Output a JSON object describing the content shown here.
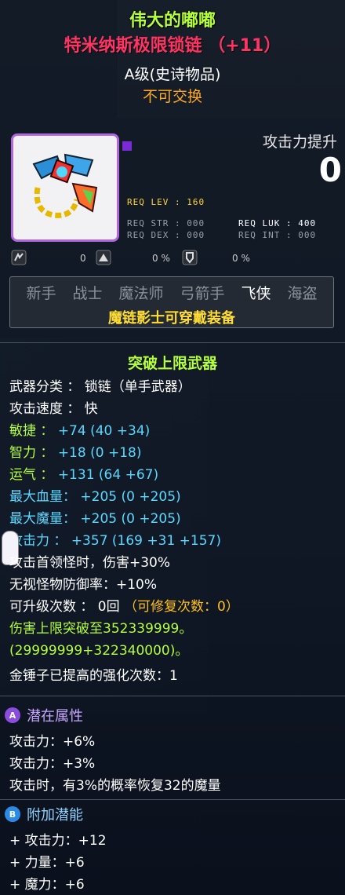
{
  "item": {
    "name": "伟大的嘟嘟",
    "full_title": "特米纳斯极限锁链 （+11）",
    "grade": "A级(史诗物品)",
    "trade": "不可交换",
    "attack_up_label": "攻击力提升",
    "attack_up_value": "0"
  },
  "requirements": {
    "lev": "REQ LEV : 160",
    "str": "REQ STR : 000",
    "dex": "REQ DEX : 000",
    "luk": "REQ LUK : 400",
    "int": "REQ INT : 000"
  },
  "stat_icons": [
    {
      "icon": "boss-damage-icon",
      "value": "0"
    },
    {
      "icon": "ignore-defense-icon",
      "value": "0 %"
    },
    {
      "icon": "shield-break-icon",
      "value": "0 %"
    }
  ],
  "jobs": {
    "list": [
      "新手",
      "战士",
      "魔法师",
      "弓箭手",
      "飞侠",
      "海盗"
    ],
    "active": "飞侠",
    "note": "魔链影士可穿戴装备"
  },
  "stats": {
    "section_title": "突破上限武器",
    "weapon_type_label": "武器分类 ： 锁链（单手武器）",
    "speed_label": "攻击速度 ： 快",
    "dex": {
      "label": "敏捷 ：",
      "text": "+74 (40 +34)"
    },
    "int": {
      "label": "智力 ：",
      "text": "+18 (0 +18)"
    },
    "luk": {
      "label": "运气 ：",
      "text": "+131 (64 +67)"
    },
    "maxhp": {
      "label": "最大血量：",
      "text": "+205 (0 +205)"
    },
    "maxmp": {
      "label": "最大魔量：",
      "text": "+205 (0 +205)"
    },
    "atk": {
      "label": "攻击力 ：",
      "text": "+357 (169 +31 +157)"
    },
    "boss": "攻击首领怪时，伤害+30%",
    "ignore_def": "无视怪物防御率：+10%",
    "upgrades": "可升级次数 ： 0回",
    "repair": "（可修复次数：0）",
    "dmg_cap_1": "伤害上限突破至352339999。",
    "dmg_cap_2": "(29999999+322340000)。",
    "hammer": "金锤子已提高的强化次数：1"
  },
  "potential": {
    "title": "潜在属性",
    "badge": "A",
    "lines": [
      "攻击力：+6%",
      "攻击力：+3%",
      "攻击时，有3%的概率恢复32的魔量"
    ]
  },
  "bonus_potential": {
    "title": "附加潜能",
    "badge": "B",
    "lines": [
      "+ 攻击力：+12",
      "+ 力量：+6",
      "+ 魔力：+6"
    ]
  },
  "colors": {
    "name": "#b5ff3b",
    "title": "#ff3366",
    "cyan_stat": "#5ad8ff",
    "gold": "#ffc11a",
    "epic_border": "#b066e0"
  }
}
